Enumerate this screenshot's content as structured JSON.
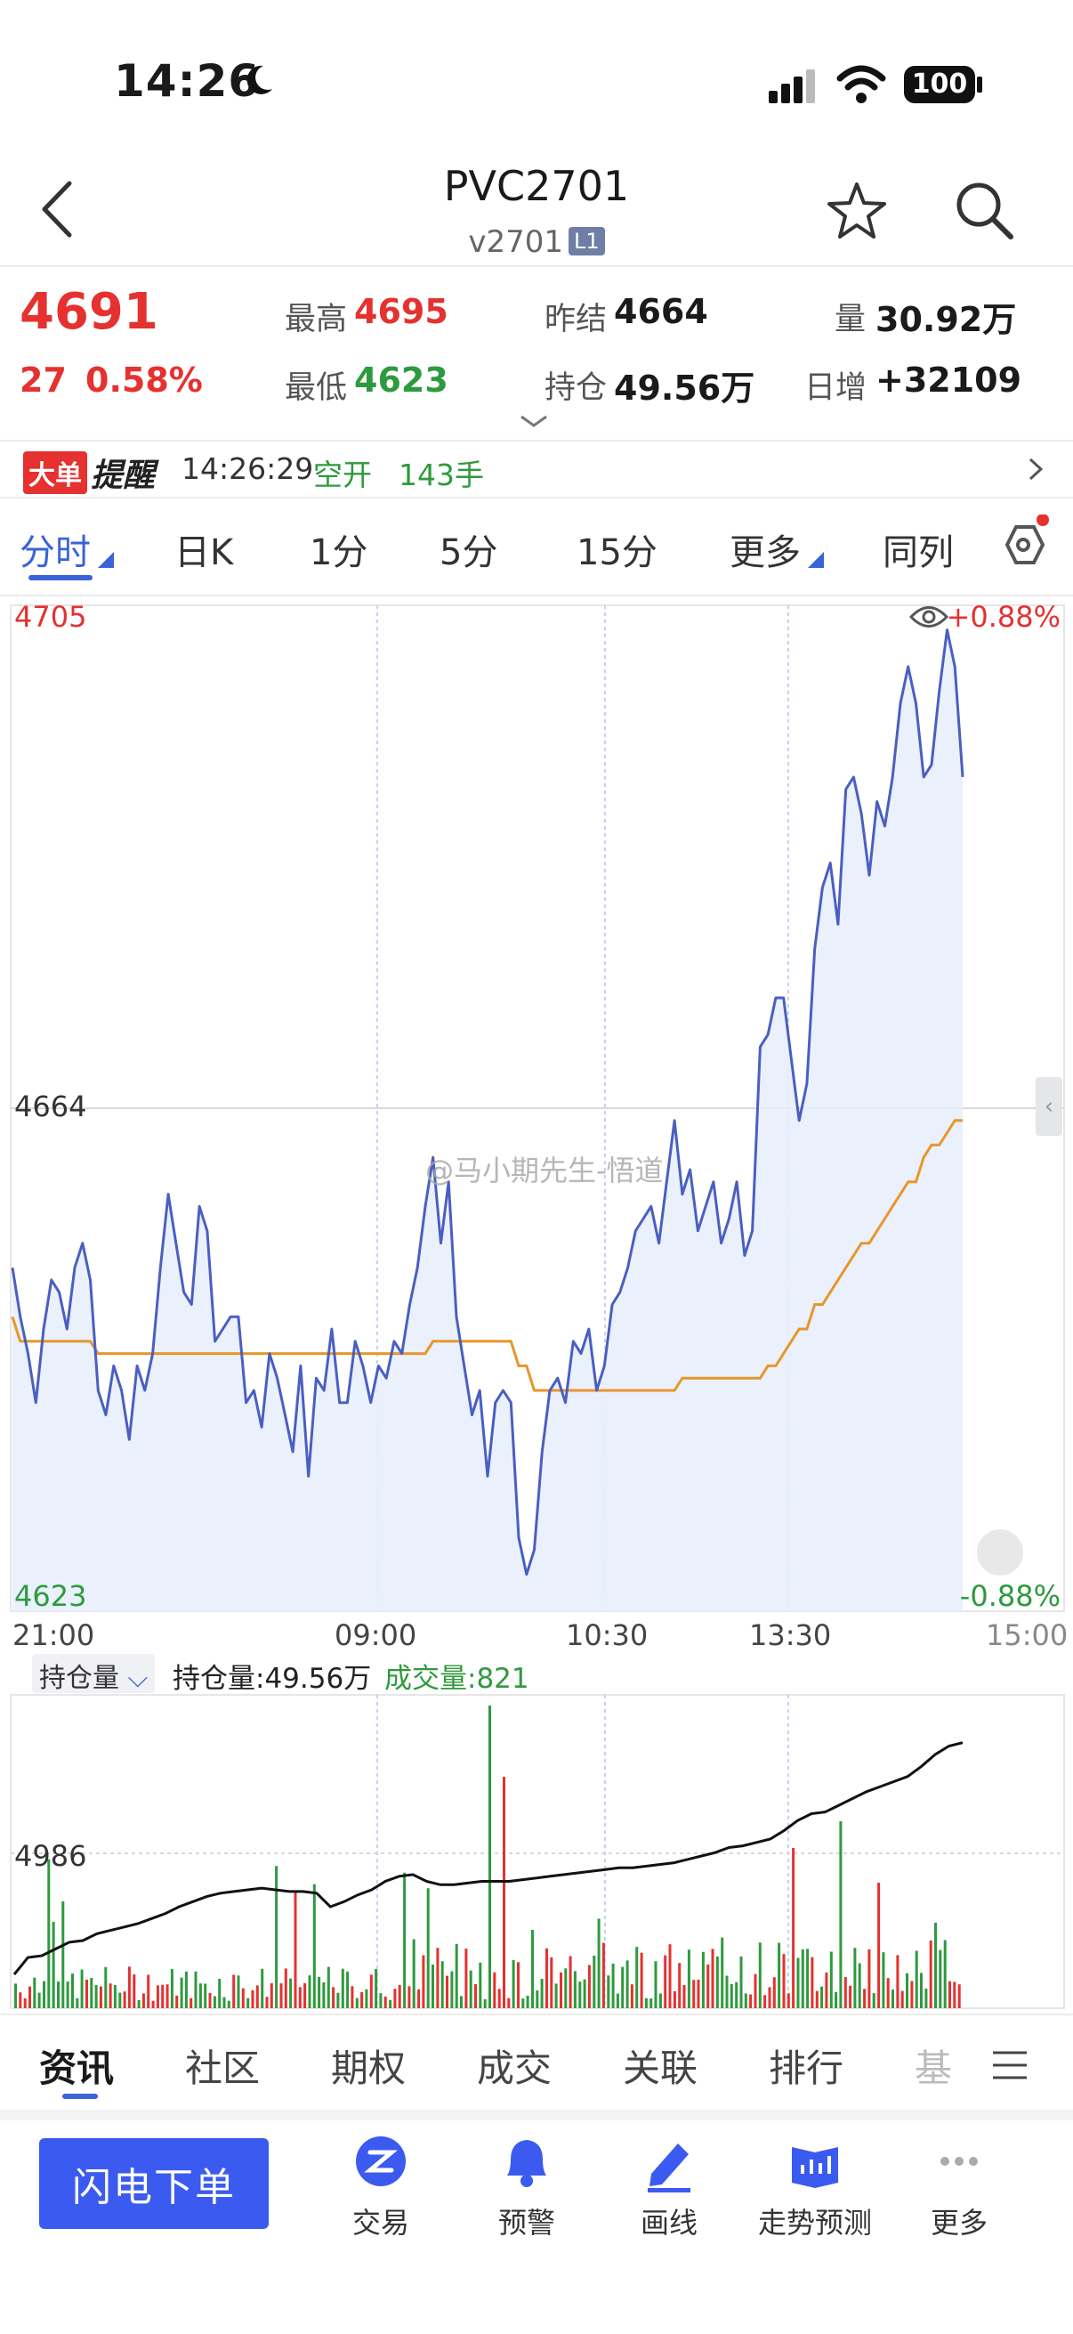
{
  "status_bar": {
    "time": "14:26",
    "battery": "100"
  },
  "header": {
    "title": "PVC2701",
    "subtitle": "v2701",
    "badge": "L1"
  },
  "quote": {
    "last": "4691",
    "change": "27",
    "change_pct": "0.58%",
    "high_label": "最高",
    "high": "4695",
    "low_label": "最低",
    "low": "4623",
    "prev_settle_label": "昨结",
    "prev_settle": "4664",
    "open_interest_label": "持仓",
    "open_interest": "49.56万",
    "volume_label": "量",
    "volume": "30.92万",
    "daily_inc_label": "日增",
    "daily_inc": "+32109"
  },
  "alert": {
    "badge": "大单",
    "title": "提醒",
    "time": "14:26:29",
    "type": "空开",
    "qty": "143手"
  },
  "chart_tabs": [
    "分时",
    "日K",
    "1分",
    "5分",
    "15分",
    "更多",
    "同列"
  ],
  "colors": {
    "accent": "#3b5bf0",
    "up": "#e5312f",
    "down": "#2e9a3e",
    "price_line": "#4a5fc1",
    "avg_line": "#e8962a"
  },
  "chart_labels": {
    "top_price": "4705",
    "mid_price": "4664",
    "bottom_price": "4623",
    "top_pct": "+0.88%",
    "bottom_pct": "-0.88%",
    "watermark": "@马小期先生-悟道",
    "times": [
      "21:00",
      "09:00",
      "10:30",
      "13:30",
      "15:00"
    ]
  },
  "sub_chart": {
    "selector": "持仓量",
    "oi_label": "持仓量:49.56万",
    "vol_label": "成交量:821",
    "ref_value": "4986"
  },
  "chart_data": {
    "type": "line",
    "title": "",
    "ylim": [
      4623,
      4705
    ],
    "x_ticks": [
      "21:00",
      "09:00",
      "10:30",
      "13:30",
      "15:00"
    ],
    "series": [
      {
        "name": "",
        "values": [
          4651,
          4647,
          4644,
          4640,
          4646,
          4650,
          4649,
          4646,
          4651,
          4653,
          4650,
          4641,
          4639,
          4643,
          4641,
          4637,
          4643,
          4641,
          4644,
          4651,
          4657,
          4653,
          4649,
          4648,
          4656,
          4654,
          4645,
          4646,
          4647,
          4647,
          4640,
          4641,
          4638,
          4644,
          4642,
          4639,
          4636,
          4643,
          4634,
          4642,
          4641,
          4646,
          4640,
          4640,
          4645,
          4643,
          4640,
          4643,
          4642,
          4645,
          4644,
          4648,
          4651,
          4656,
          4660,
          4653,
          4658,
          4647,
          4643,
          4639,
          4641,
          4634,
          4640,
          4641,
          4640,
          4629,
          4626,
          4628,
          4636,
          4641,
          4642,
          4640,
          4645,
          4644,
          4646,
          4641,
          4643,
          4648,
          4649,
          4651,
          4654,
          4655,
          4656,
          4653,
          4658,
          4663,
          4657,
          4659,
          4654,
          4656,
          4658,
          4653,
          4655,
          4658,
          4652,
          4654,
          4669,
          4670,
          4673,
          4673,
          4668,
          4663,
          4666,
          4677,
          4682,
          4684,
          4679,
          4690,
          4691,
          4688,
          4683,
          4689,
          4687,
          4691,
          4697,
          4700,
          4697,
          4691,
          4692,
          4698,
          4703,
          4700,
          4691
        ]
      },
      {
        "name": "",
        "values": [
          4647,
          4645,
          4645,
          4645,
          4645,
          4645,
          4645,
          4645,
          4645,
          4645,
          4645,
          4644,
          4644,
          4644,
          4644,
          4644,
          4644,
          4644,
          4644,
          4644,
          4644,
          4644,
          4644,
          4644,
          4644,
          4644,
          4644,
          4644,
          4644,
          4644,
          4644,
          4644,
          4644,
          4644,
          4644,
          4644,
          4644,
          4644,
          4644,
          4644,
          4644,
          4644,
          4644,
          4644,
          4644,
          4644,
          4644,
          4644,
          4644,
          4644,
          4644,
          4644,
          4644,
          4644,
          4645,
          4645,
          4645,
          4645,
          4645,
          4645,
          4645,
          4645,
          4645,
          4645,
          4645,
          4643,
          4643,
          4641,
          4641,
          4641,
          4641,
          4641,
          4641,
          4641,
          4641,
          4641,
          4641,
          4641,
          4641,
          4641,
          4641,
          4641,
          4641,
          4641,
          4641,
          4641,
          4642,
          4642,
          4642,
          4642,
          4642,
          4642,
          4642,
          4642,
          4642,
          4642,
          4642,
          4643,
          4643,
          4644,
          4645,
          4646,
          4646,
          4648,
          4648,
          4649,
          4650,
          4651,
          4652,
          4653,
          4653,
          4654,
          4655,
          4656,
          4657,
          4658,
          4658,
          4660,
          4661,
          4661,
          4662,
          4663,
          4663
        ]
      }
    ]
  },
  "info_tabs": [
    "资讯",
    "社区",
    "期权",
    "成交",
    "关联",
    "排行",
    "基"
  ],
  "bottom_bar": {
    "order_button": "闪电下单",
    "items": [
      "交易",
      "预警",
      "画线",
      "走势预测",
      "更多"
    ]
  }
}
